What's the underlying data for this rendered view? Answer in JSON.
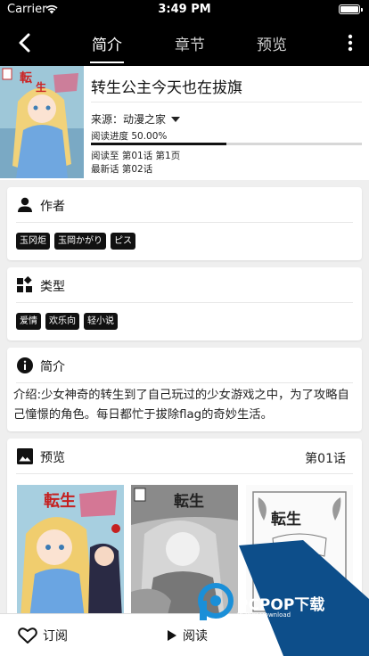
{
  "status_bar": {
    "carrier": "Carrier",
    "time": "3:49 PM"
  },
  "nav": {
    "tabs": [
      {
        "label": "简介",
        "active": true
      },
      {
        "label": "章节",
        "active": false
      },
      {
        "label": "预览",
        "active": false
      }
    ]
  },
  "comic": {
    "title": "转生公主今天也在拔旗",
    "source_label": "来源：动漫之家",
    "progress_label": "阅读进度 50.00%",
    "progress_fraction": 0.5,
    "read_at": "阅读至 第01话 第1页",
    "latest": "最新话 第02话"
  },
  "author_card": {
    "heading": "作者",
    "tags": [
      "玉冈炬",
      "玉岡かがり",
      "ピス"
    ]
  },
  "genre_card": {
    "heading": "类型",
    "tags": [
      "爱情",
      "欢乐向",
      "轻小说"
    ]
  },
  "summary_card": {
    "heading": "简介",
    "text": "介绍:少女神奇的转生到了自己玩过的少女游戏之中，为了攻略自己憧憬的角色。每日都忙于拔除flag的奇妙生活。"
  },
  "preview_card": {
    "heading": "预览",
    "chapter": "第01话"
  },
  "bottom_bar": {
    "subscribe": "订阅",
    "read": "阅读"
  },
  "watermark": {
    "text": "PCPOP下载",
    "sub": "PCPOP Download"
  },
  "colors": {
    "bar": "#000000",
    "accent": "#111111",
    "watermark_blue": "#0d4e8a"
  }
}
